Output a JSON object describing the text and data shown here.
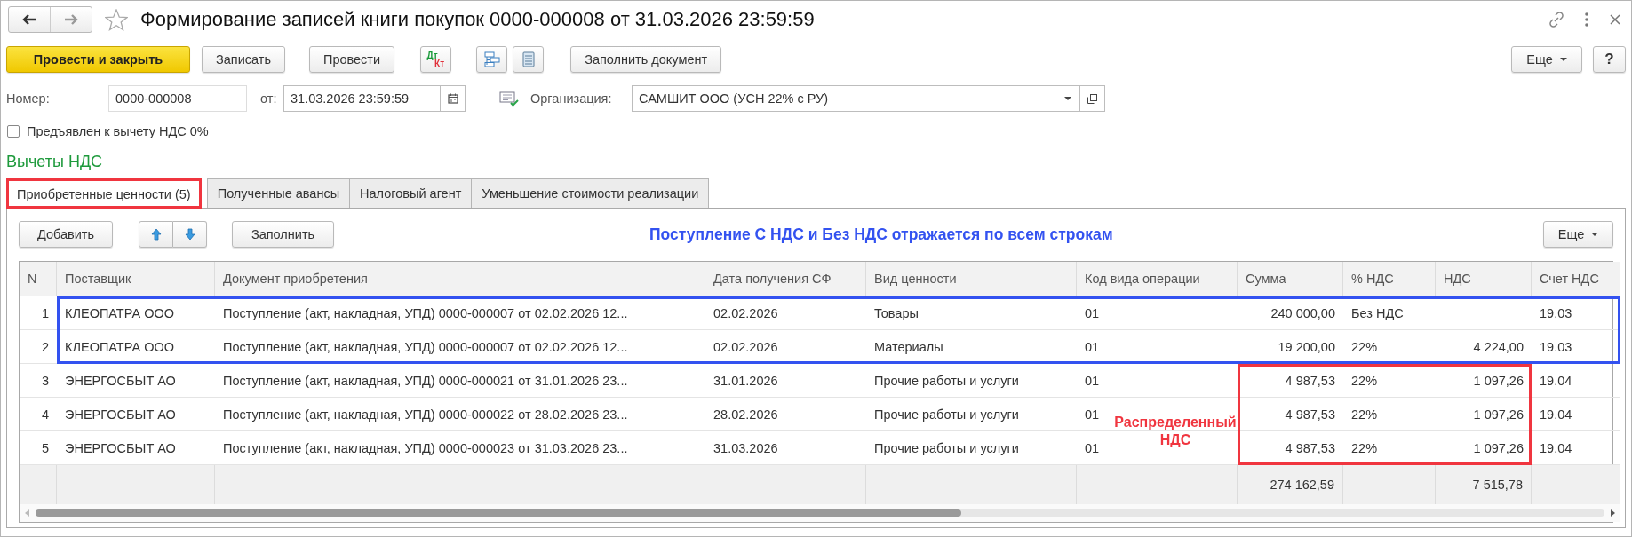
{
  "window": {
    "title": "Формирование записей книги покупок 0000-000008 от 31.03.2026 23:59:59"
  },
  "toolbar": {
    "buttons": [
      {
        "kind": "primary",
        "label": "Провести и закрыть"
      },
      {
        "kind": "plain",
        "label": "Записать"
      },
      {
        "kind": "plain",
        "label": "Провести"
      },
      {
        "kind": "dtkt",
        "top": "Дт",
        "bottom": "Кт"
      },
      {
        "kind": "structure"
      },
      {
        "kind": "list"
      },
      {
        "kind": "plain",
        "label": "Заполнить документ"
      }
    ],
    "more": "Еще",
    "help": "?"
  },
  "fields": {
    "number": {
      "label": "Номер:",
      "value": "0000-000008"
    },
    "date": {
      "label": "от:",
      "value": "31.03.2026 23:59:59"
    },
    "organization": {
      "label": "Организация:",
      "value": "САМШИТ ООО (УСН 22% с РУ)"
    }
  },
  "checkbox": {
    "label": "Предъявлен к вычету НДС 0%",
    "checked": false
  },
  "section_title": "Вычеты НДС",
  "tabs": [
    {
      "label": "Приобретенные ценности (5)",
      "selected": true,
      "highlighted": true
    },
    {
      "label": "Полученные авансы",
      "selected": false,
      "highlighted": false
    },
    {
      "label": "Налоговый агент",
      "selected": false,
      "highlighted": false
    },
    {
      "label": "Уменьшение стоимости реализации",
      "selected": false,
      "highlighted": false
    }
  ],
  "table_toolbar": {
    "add": "Добавить",
    "fill": "Заполнить",
    "more": "Еще"
  },
  "annotations": [
    {
      "kind": "caption",
      "text": "Поступление С НДС и Без НДС отражается по всем строкам",
      "color": "#3352f0"
    },
    {
      "kind": "row_frame",
      "color": "#3352f0"
    },
    {
      "kind": "cell_frame",
      "color": "#f0353f"
    },
    {
      "kind": "note",
      "text": "Распределенный НДС",
      "color": "#f0353f"
    }
  ],
  "table": {
    "columns": [
      "N",
      "Поставщик",
      "Документ приобретения",
      "Дата получения СФ",
      "Вид ценности",
      "Код вида операции",
      "Сумма",
      "% НДС",
      "НДС",
      "Счет НДС"
    ],
    "rows": [
      {
        "n": "1",
        "supplier": "КЛЕОПАТРА ООО",
        "document": "Поступление (акт, накладная, УПД) 0000-000007 от 02.02.2026 12...",
        "received": "02.02.2026",
        "value_type": "Товары",
        "operation_code": "01",
        "amount": "240 000,00",
        "vat_rate": "Без НДС",
        "vat_account": "19.03"
      },
      {
        "n": "2",
        "supplier": "КЛЕОПАТРА ООО",
        "document": "Поступление (акт, накладная, УПД) 0000-000007 от 02.02.2026 12...",
        "received": "02.02.2026",
        "value_type": "Материалы",
        "operation_code": "01",
        "amount": "19 200,00",
        "vat_rate": "22%",
        "vat": "4 224,00",
        "vat_account": "19.03"
      },
      {
        "n": "3",
        "supplier": "ЭНЕРГОСБЫТ АО",
        "document": "Поступление (акт, накладная, УПД) 0000-000021 от 31.01.2026 23...",
        "received": "31.01.2026",
        "value_type": "Прочие работы и услуги",
        "operation_code": "01",
        "amount": "4 987,53",
        "vat_rate": "22%",
        "vat": "1 097,26",
        "vat_account": "19.04"
      },
      {
        "n": "4",
        "supplier": "ЭНЕРГОСБЫТ АО",
        "document": "Поступление (акт, накладная, УПД) 0000-000022 от 28.02.2026 23...",
        "received": "28.02.2026",
        "value_type": "Прочие работы и услуги",
        "operation_code": "01",
        "amount": "4 987,53",
        "vat_rate": "22%",
        "vat": "1 097,26",
        "vat_account": "19.04"
      },
      {
        "n": "5",
        "supplier": "ЭНЕРГОСБЫТ АО",
        "document": "Поступление (акт, накладная, УПД) 0000-000023 от 31.03.2026 23...",
        "received": "31.03.2026",
        "value_type": "Прочие работы и услуги",
        "operation_code": "01",
        "amount": "4 987,53",
        "vat_rate": "22%",
        "vat": "1 097,26",
        "vat_account": "19.04"
      }
    ],
    "totals": {
      "amount": "274 162,59",
      "vat": "7 515,78"
    }
  }
}
